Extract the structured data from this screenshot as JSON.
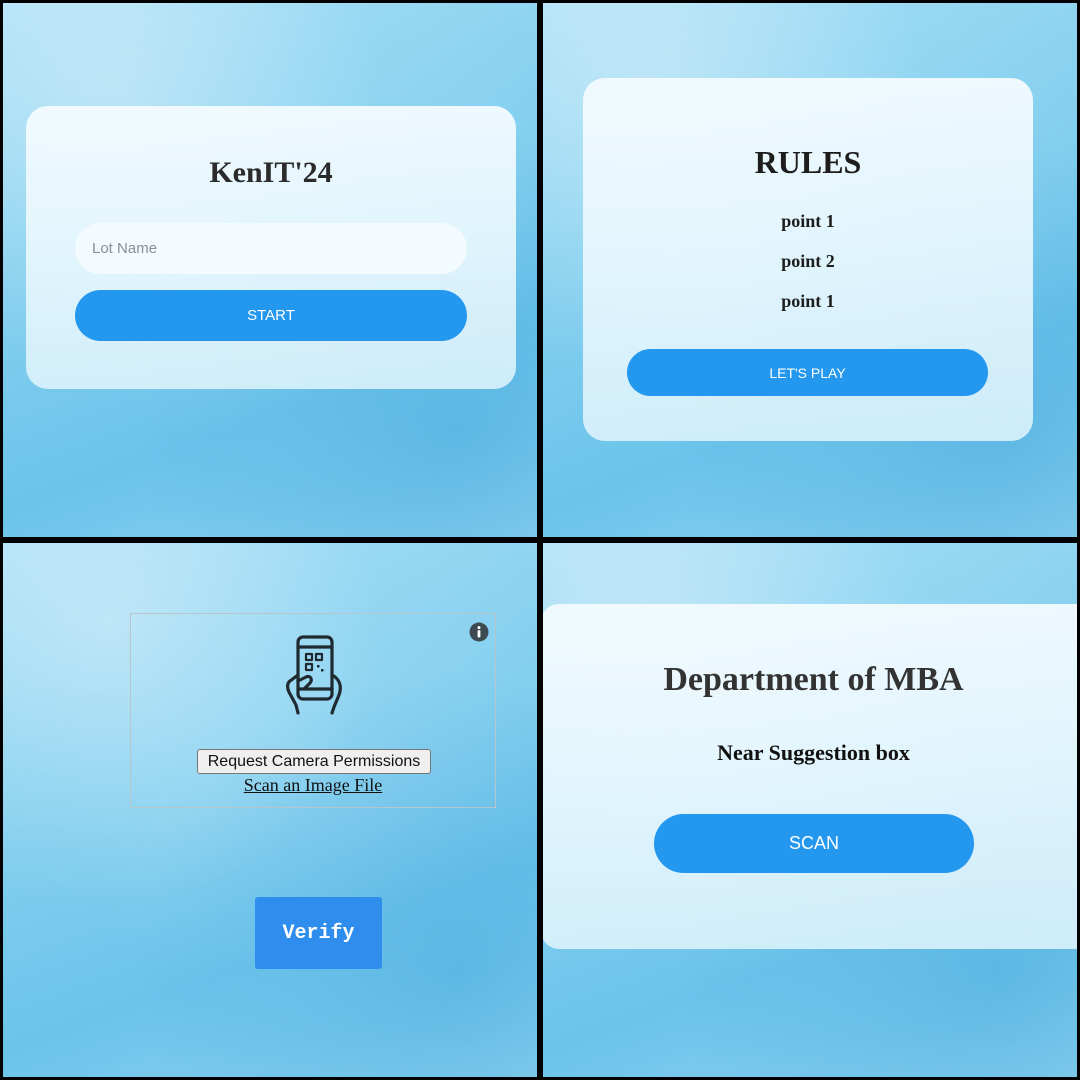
{
  "start_screen": {
    "title": "KenIT'24",
    "lot_placeholder": "Lot Name",
    "start_label": "START"
  },
  "rules_screen": {
    "title": "RULES",
    "points": [
      "point 1",
      "point 2",
      "point 1"
    ],
    "play_label": "LET'S PLAY"
  },
  "scanner_screen": {
    "info_icon": "info-icon",
    "phone_icon": "phone-qr-scan-icon",
    "camera_button_label": "Request Camera Permissions",
    "scan_file_label": "Scan an Image File",
    "verify_label": "Verify"
  },
  "location_screen": {
    "title": "Department of MBA",
    "location": "Near Suggestion box",
    "scan_label": "SCAN"
  },
  "colors": {
    "accent_blue": "#2497ee",
    "verify_blue": "#2f8ded",
    "card_bg": "#eaf8fe"
  }
}
